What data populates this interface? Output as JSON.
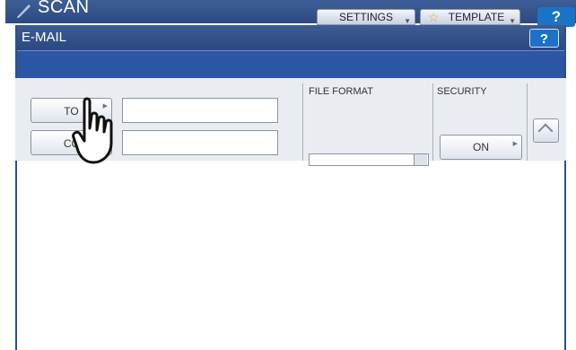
{
  "scan_bar": {
    "title": "SCAN",
    "icon": "scan-pen-icon",
    "settings_label": "SETTINGS",
    "template_label": "TEMPLATE",
    "help_label": "?"
  },
  "dialog": {
    "title": "E-MAIL",
    "help_label": "?"
  },
  "address": {
    "to_label": "TO",
    "to_value": "",
    "cc_label": "CC",
    "cc_value": ""
  },
  "file_format": {
    "label": "FILE FORMAT",
    "value": ""
  },
  "security": {
    "label": "SECURITY",
    "button_label": "ON"
  },
  "colors": {
    "header_blue": "#2b4880",
    "band_blue": "#2a56a4",
    "help_blue": "#1a73c7",
    "panel_gray": "#e9ecf1"
  },
  "icons": [
    "scan-pen-icon",
    "star-icon",
    "chevron-down-icon",
    "chevron-up-icon",
    "pointing-hand-icon"
  ]
}
